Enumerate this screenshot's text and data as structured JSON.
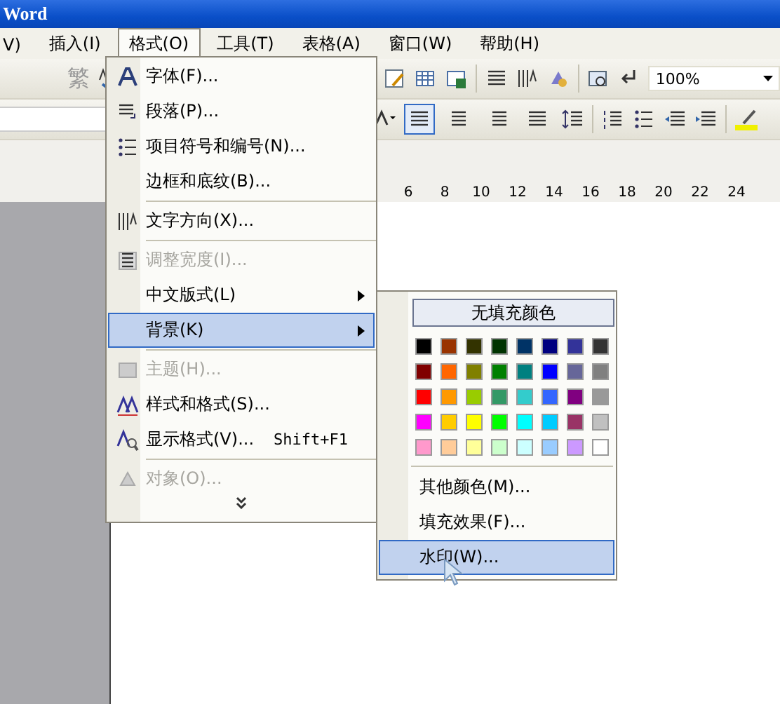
{
  "window": {
    "title": "Word"
  },
  "menu_bar": [
    {
      "label": "V)",
      "selected": false
    },
    {
      "label": "插入(I)",
      "selected": false
    },
    {
      "label": "格式(O)",
      "selected": true
    },
    {
      "label": "工具(T)",
      "selected": false
    },
    {
      "label": "表格(A)",
      "selected": false
    },
    {
      "label": "窗口(W)",
      "selected": false
    },
    {
      "label": "帮助(H)",
      "selected": false
    }
  ],
  "standard_toolbar": {
    "traditional_button": "繁",
    "zoom": "100%"
  },
  "formatting_toolbar": {
    "alignment_buttons": [
      {
        "selected": true
      },
      {
        "selected": false
      },
      {
        "selected": false
      },
      {
        "selected": false
      }
    ]
  },
  "ruler": [
    "6",
    "8",
    "10",
    "12",
    "14",
    "16",
    "18",
    "20",
    "22",
    "24"
  ],
  "format_menu": {
    "groups": [
      [
        {
          "label": "字体(F)...",
          "disabled": false,
          "submenu": false,
          "selected": false
        },
        {
          "label": "段落(P)...",
          "disabled": false,
          "submenu": false,
          "selected": false
        },
        {
          "label": "项目符号和编号(N)...",
          "disabled": false,
          "submenu": false,
          "selected": false
        },
        {
          "label": "边框和底纹(B)...",
          "disabled": false,
          "submenu": false,
          "selected": false
        }
      ],
      [
        {
          "label": "文字方向(X)...",
          "disabled": false,
          "submenu": false,
          "selected": false
        }
      ],
      [
        {
          "label": "调整宽度(I)...",
          "disabled": true,
          "submenu": false,
          "selected": false
        },
        {
          "label": "中文版式(L)",
          "disabled": false,
          "submenu": true,
          "selected": false
        },
        {
          "label": "背景(K)",
          "disabled": false,
          "submenu": true,
          "selected": true
        }
      ],
      [
        {
          "label": "主题(H)...",
          "disabled": true,
          "submenu": false,
          "selected": false
        },
        {
          "label": "样式和格式(S)...",
          "disabled": false,
          "submenu": false,
          "selected": false
        },
        {
          "label": "显示格式(V)...",
          "shortcut": "Shift+F1",
          "disabled": false,
          "submenu": false,
          "selected": false
        }
      ],
      [
        {
          "label": "对象(O)...",
          "disabled": true,
          "submenu": false,
          "selected": false
        }
      ]
    ]
  },
  "background_submenu": {
    "no_fill": "无填充颜色",
    "swatches": [
      {
        "color": "#000000"
      },
      {
        "color": "#993300"
      },
      {
        "color": "#333300"
      },
      {
        "color": "#003300"
      },
      {
        "color": "#003366"
      },
      {
        "color": "#000080"
      },
      {
        "color": "#333399"
      },
      {
        "color": "#333333"
      },
      {
        "color": "#800000"
      },
      {
        "color": "#ff6600"
      },
      {
        "color": "#808000"
      },
      {
        "color": "#008000"
      },
      {
        "color": "#008080"
      },
      {
        "color": "#0000ff"
      },
      {
        "color": "#666699"
      },
      {
        "color": "#808080"
      },
      {
        "color": "#ff0000"
      },
      {
        "color": "#ff9900"
      },
      {
        "color": "#99cc00"
      },
      {
        "color": "#339966"
      },
      {
        "color": "#33cccc"
      },
      {
        "color": "#3366ff"
      },
      {
        "color": "#800080"
      },
      {
        "color": "#999999"
      },
      {
        "color": "#ff00ff"
      },
      {
        "color": "#ffcc00"
      },
      {
        "color": "#ffff00"
      },
      {
        "color": "#00ff00"
      },
      {
        "color": "#00ffff"
      },
      {
        "color": "#00ccff"
      },
      {
        "color": "#993366"
      },
      {
        "color": "#c0c0c0"
      },
      {
        "color": "#ff99cc"
      },
      {
        "color": "#ffcc99"
      },
      {
        "color": "#ffff99"
      },
      {
        "color": "#ccffcc"
      },
      {
        "color": "#ccffff"
      },
      {
        "color": "#99ccff"
      },
      {
        "color": "#cc99ff"
      },
      {
        "color": "#ffffff"
      }
    ],
    "items": [
      {
        "label": "其他颜色(M)...",
        "selected": false
      },
      {
        "label": "填充效果(F)...",
        "selected": false
      },
      {
        "label": "水印(W)...",
        "selected": true
      }
    ]
  }
}
